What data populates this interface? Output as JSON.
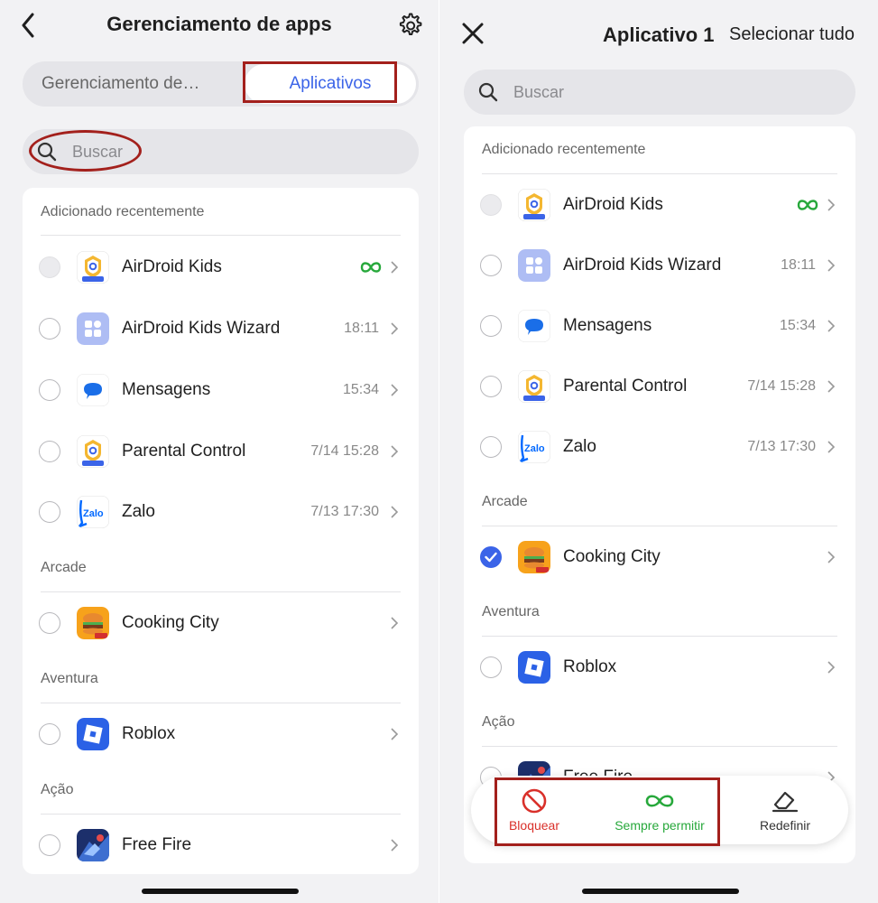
{
  "left": {
    "header_title": "Gerenciamento de apps",
    "tab_left": "Gerenciamento de…",
    "tab_right": "Aplicativos",
    "search_placeholder": "Buscar",
    "sections": {
      "recent": "Adicionado recentemente",
      "arcade": "Arcade",
      "adventure": "Aventura",
      "action": "Ação"
    },
    "apps": [
      {
        "name": "AirDroid Kids",
        "meta": ""
      },
      {
        "name": "AirDroid Kids Wizard",
        "meta": "18:11"
      },
      {
        "name": "Mensagens",
        "meta": "15:34"
      },
      {
        "name": "Parental Control",
        "meta": "7/14 15:28"
      },
      {
        "name": "Zalo",
        "meta": "7/13 17:30"
      },
      {
        "name": "Cooking City",
        "meta": ""
      },
      {
        "name": "Roblox",
        "meta": ""
      },
      {
        "name": "Free Fire",
        "meta": ""
      }
    ]
  },
  "right": {
    "title": "Aplicativo 1",
    "select_all": "Selecionar tudo",
    "search_placeholder": "Buscar",
    "sections": {
      "recent": "Adicionado recentemente",
      "arcade": "Arcade",
      "adventure": "Aventura",
      "action": "Ação"
    },
    "apps": [
      {
        "name": "AirDroid Kids",
        "meta": ""
      },
      {
        "name": "AirDroid Kids Wizard",
        "meta": "18:11"
      },
      {
        "name": "Mensagens",
        "meta": "15:34"
      },
      {
        "name": "Parental Control",
        "meta": "7/14 15:28"
      },
      {
        "name": "Zalo",
        "meta": "7/13 17:30"
      },
      {
        "name": "Cooking City",
        "meta": ""
      },
      {
        "name": "Roblox",
        "meta": ""
      },
      {
        "name": "Free Fire",
        "meta": ""
      }
    ],
    "actions": {
      "block": "Bloquear",
      "always_allow": "Sempre permitir",
      "reset": "Redefinir"
    }
  },
  "colors": {
    "accent": "#3b64e8",
    "allow_green": "#27a83b",
    "block_red": "#d9302a",
    "highlight_red": "#a3201c"
  },
  "icons": {
    "back": "chevron-left-icon",
    "settings": "gear-icon",
    "search": "search-icon",
    "close": "close-icon",
    "always": "infinity-icon",
    "block": "block-icon",
    "reset": "eraser-icon",
    "check": "check-icon"
  }
}
